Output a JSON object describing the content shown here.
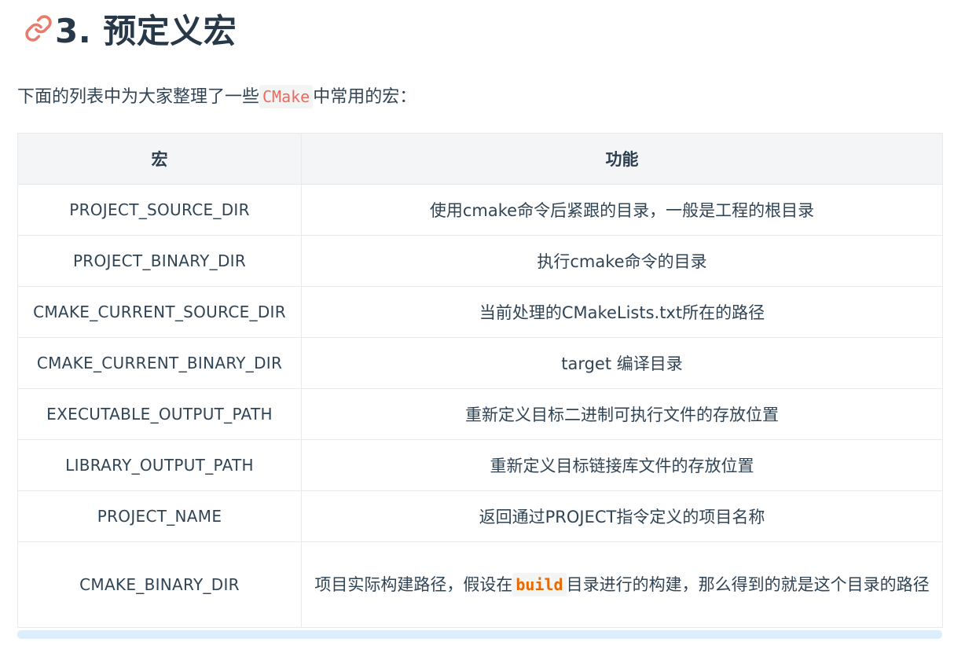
{
  "heading": {
    "text": "3. 预定义宏"
  },
  "intro": {
    "before": "下面的列表中为大家整理了一些",
    "code": "CMake",
    "after": "中常用的宏："
  },
  "table": {
    "headers": [
      "宏",
      "功能"
    ],
    "rows": [
      {
        "name": "PROJECT_SOURCE_DIR",
        "desc": "使用cmake命令后紧跟的目录，一般是工程的根目录"
      },
      {
        "name": "PROJECT_BINARY_DIR",
        "desc": "执行cmake命令的目录"
      },
      {
        "name": "CMAKE_CURRENT_SOURCE_DIR",
        "desc": "当前处理的CMakeLists.txt所在的路径"
      },
      {
        "name": "CMAKE_CURRENT_BINARY_DIR",
        "desc": "target 编译目录"
      },
      {
        "name": "EXECUTABLE_OUTPUT_PATH",
        "desc": "重新定义目标二进制可执行文件的存放位置"
      },
      {
        "name": "LIBRARY_OUTPUT_PATH",
        "desc": "重新定义目标链接库文件的存放位置"
      },
      {
        "name": "PROJECT_NAME",
        "desc": "返回通过PROJECT指令定义的项目名称"
      },
      {
        "name": "CMAKE_BINARY_DIR",
        "desc_before": "项目实际构建路径，假设在",
        "desc_code": "build",
        "desc_after": "目录进行的构建，那么得到的就是这个目录的路径"
      }
    ]
  },
  "colors": {
    "anchor_icon": "#ea7a6c",
    "code_text": "#e96900",
    "header_bg": "#f3f5f7",
    "scrollbar": "#dceefb"
  },
  "icons": {
    "anchor": "link-icon"
  }
}
